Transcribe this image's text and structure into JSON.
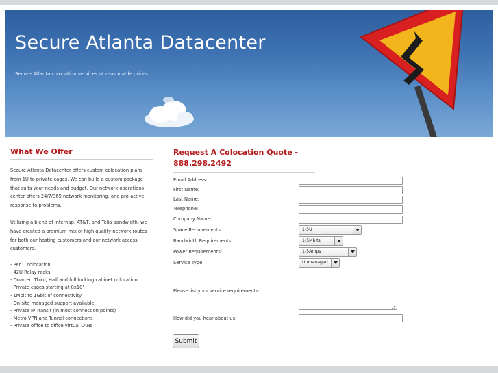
{
  "banner": {
    "title": "Secure Atlanta Datacenter",
    "tagline": "Secure Atlanta colocation services at reasonable prices"
  },
  "offer": {
    "heading": "What We Offer",
    "para1": "Secure Atlanta Datacenter offers custom colocation plans from 1U to private cages. We can build a custom package that suits your needs and budget. Our network operations center offers 24/7/365 network monitoring, and pro-active response to problems.",
    "para2": "Utilizing a blend of Internap, AT&T, and Telia bandwidth, we have created a premium mix of high quality network routes for both our hosting customers and our network access customers.",
    "items": [
      "- Per U colocation",
      "- 42U Relay racks",
      "- Quarter, Third, Half and full locking cabinet colocation",
      "- Private cages starting at 8x10'",
      "- 1Mbit to 1Gbit of connectivity",
      "- On-site managed support available",
      "- Private IP Transit (in most connection points)",
      "- Metro VPN and Tunnel connections",
      "- Private office to office virtual LANs"
    ]
  },
  "quote": {
    "heading": "Request A Colocation Quote - 888.298.2492",
    "labels": {
      "email": "Email Address:",
      "first": "First Name:",
      "last": "Last Name:",
      "phone": "Telephone:",
      "company": "Company Name:",
      "space": "Space Requirements:",
      "bandwidth": "Bandwidth Requirements:",
      "power": "Power Requirements:",
      "service": "Service Type:",
      "requirements": "Please list your service requirements:",
      "hear": "How did you hear about us:"
    },
    "selects": {
      "space": "1-5U",
      "bandwidth": "1-5Mbits",
      "power": "1-5Amps",
      "service": "Unmanaged"
    },
    "submit": "Submit"
  },
  "colors": {
    "heading_red": "#b31b1b",
    "sky_blue": "#3f73b3",
    "sign_yellow": "#f2b51c",
    "sign_red": "#d7201f"
  }
}
